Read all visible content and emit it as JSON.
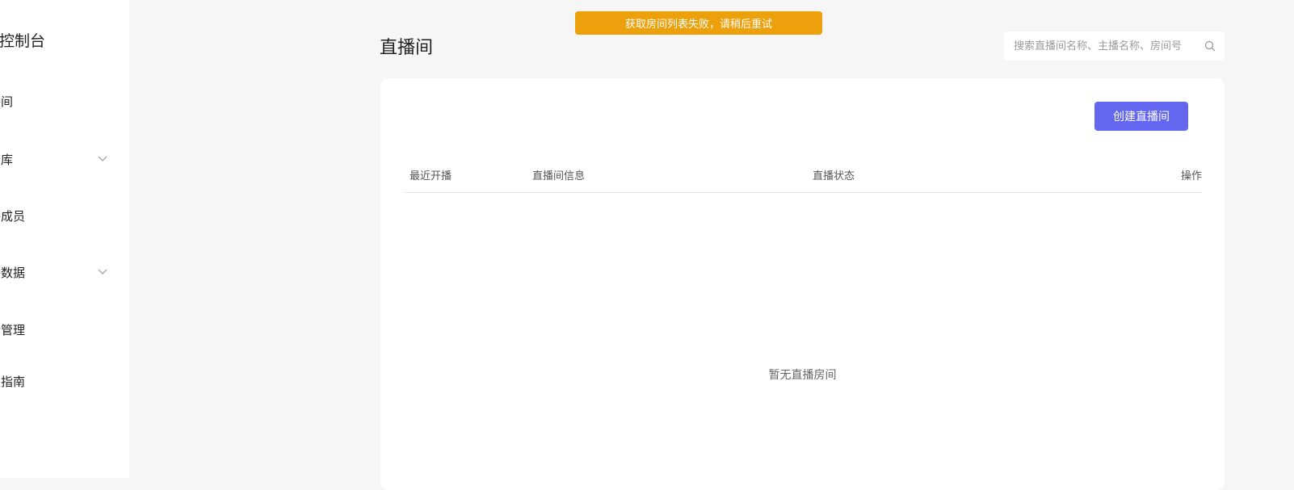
{
  "sidebar": {
    "brand": "播控制台",
    "items": [
      {
        "label": "播间",
        "has_chevron": false
      },
      {
        "label": "品库",
        "has_chevron": true
      },
      {
        "label": "播成员",
        "has_chevron": false
      },
      {
        "label": "播数据",
        "has_chevron": true
      },
      {
        "label": "论管理",
        "has_chevron": false
      },
      {
        "label": "入指南",
        "has_chevron": false
      }
    ]
  },
  "toast": {
    "message": "获取房间列表失败，请稍后重试",
    "color": "#eba00c"
  },
  "header": {
    "title": "直播间",
    "search_placeholder": "搜索直播间名称、主播名称、房间号",
    "search_icon": "search-icon"
  },
  "main": {
    "create_button_label": "创建直播间",
    "accent_color": "#6366ee",
    "columns": [
      "最近开播",
      "直播间信息",
      "直播状态",
      "操作"
    ],
    "empty_text": "暂无直播房间"
  }
}
